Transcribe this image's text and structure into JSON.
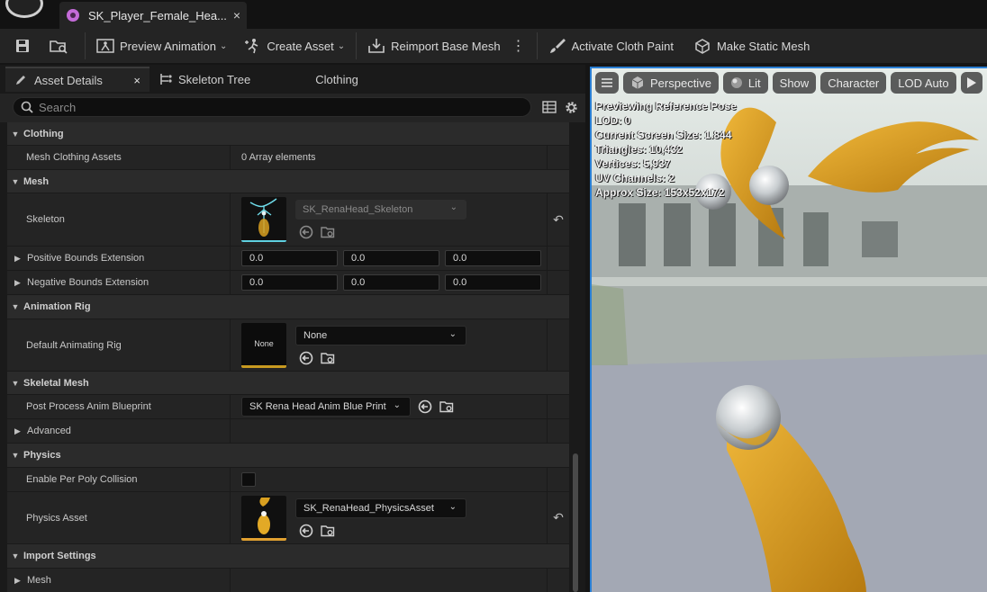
{
  "tab": {
    "title": "SK_Player_Female_Hea...",
    "close": "×"
  },
  "toolbar": {
    "preview_animation": "Preview Animation",
    "create_asset": "Create Asset",
    "reimport_base_mesh": "Reimport Base Mesh",
    "activate_cloth_paint": "Activate Cloth Paint",
    "make_static_mesh": "Make Static Mesh",
    "more": "⋮",
    "dropdown_glyph": "⌄"
  },
  "panel_tabs": {
    "asset_details": "Asset Details",
    "asset_details_close": "×",
    "skeleton_tree": "Skeleton Tree",
    "clothing": "Clothing"
  },
  "search": {
    "placeholder": "Search"
  },
  "details": {
    "clothing": {
      "header": "Clothing",
      "mesh_clothing_assets_label": "Mesh Clothing Assets",
      "mesh_clothing_assets_value": "0 Array elements"
    },
    "mesh": {
      "header": "Mesh",
      "skeleton_label": "Skeleton",
      "skeleton_value": "SK_RenaHead_Skeleton",
      "positive_bounds_label": "Positive Bounds Extension",
      "positive_bounds": [
        "0.0",
        "0.0",
        "0.0"
      ],
      "negative_bounds_label": "Negative Bounds Extension",
      "negative_bounds": [
        "0.0",
        "0.0",
        "0.0"
      ]
    },
    "animation_rig": {
      "header": "Animation Rig",
      "default_rig_label": "Default Animating Rig",
      "default_rig_thumb": "None",
      "default_rig_value": "None"
    },
    "skeletal_mesh": {
      "header": "Skeletal Mesh",
      "post_process_label": "Post Process Anim Blueprint",
      "post_process_value": "SK Rena Head Anim Blue Print",
      "advanced_label": "Advanced"
    },
    "physics": {
      "header": "Physics",
      "per_poly_label": "Enable Per Poly Collision",
      "per_poly_checked": false,
      "physics_asset_label": "Physics Asset",
      "physics_asset_value": "SK_RenaHead_PhysicsAsset"
    },
    "import_settings": {
      "header": "Import Settings",
      "mesh_label": "Mesh"
    },
    "reset_glyph": "↶"
  },
  "viewport": {
    "perspective": "Perspective",
    "lit": "Lit",
    "show": "Show",
    "character": "Character",
    "lod_auto": "LOD Auto",
    "stats": {
      "line1": "Previewing Reference Pose",
      "line2": "LOD: 0",
      "line3": "Current Screen Size: 1.844",
      "line4": "Triangles: 10,432",
      "line5": "Vertices: 5,937",
      "line6": "UV Channels: 2",
      "line7": "Approx Size: 153x52x172"
    }
  },
  "colors": {
    "accent_blue": "#2a7fd4",
    "asset_gold": "#d9a020",
    "skeleton_cyan": "#5fd0e0"
  }
}
